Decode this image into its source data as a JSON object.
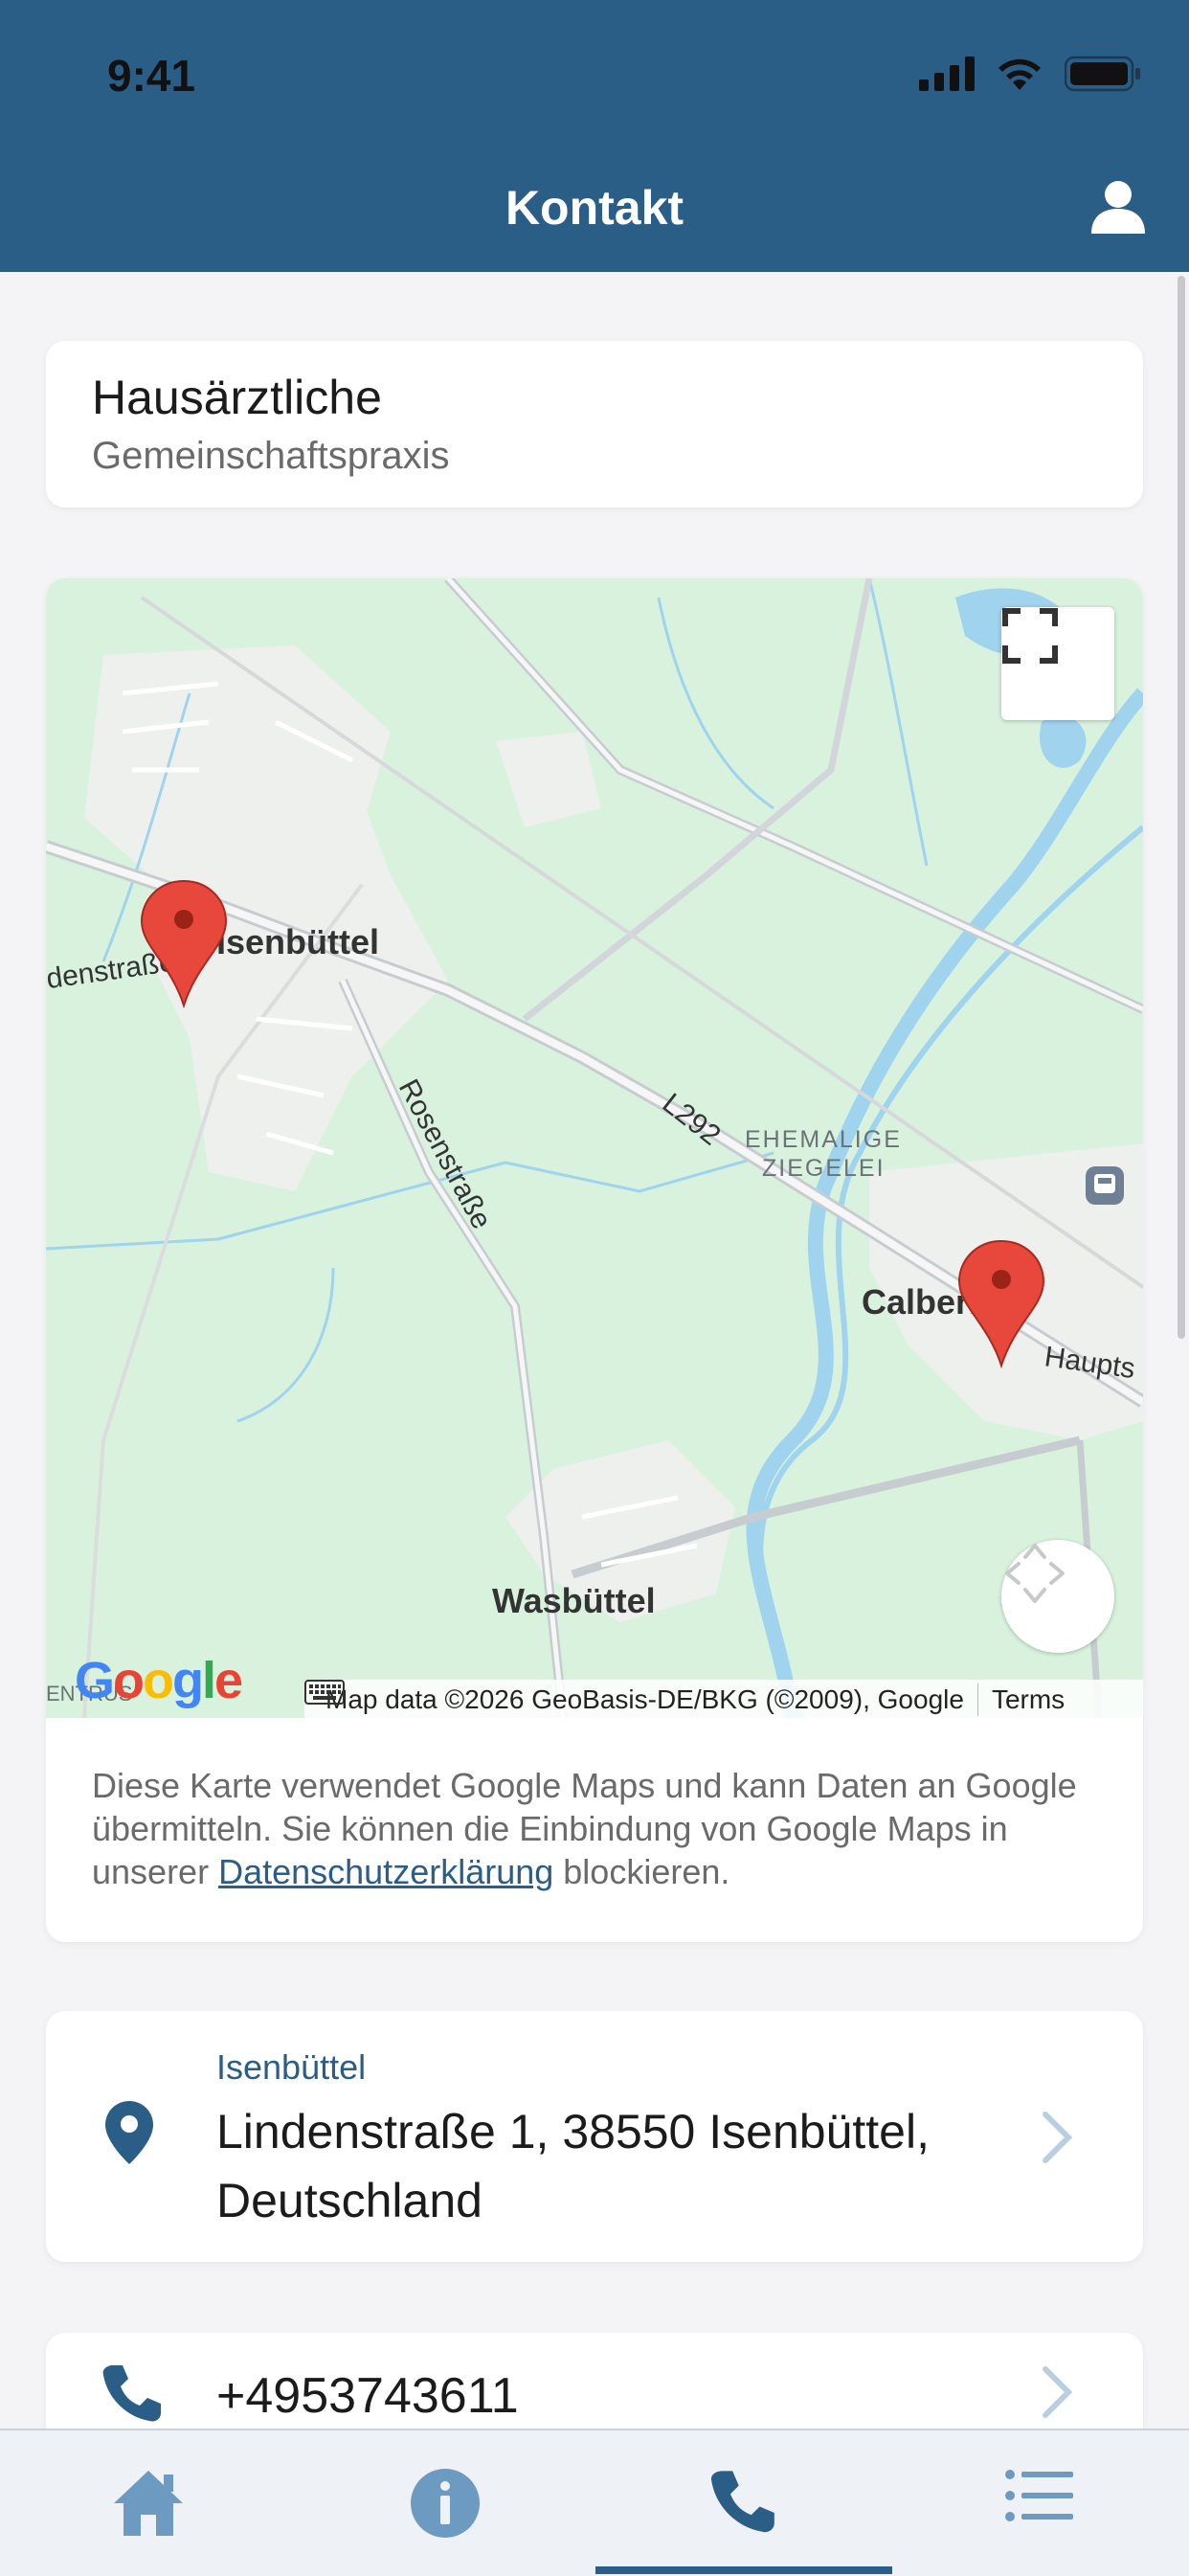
{
  "status_bar": {
    "time": "9:41"
  },
  "header": {
    "title": "Kontakt"
  },
  "practice": {
    "name": "Hausärztliche",
    "subtitle": "Gemeinschaftspraxis"
  },
  "map": {
    "labels": {
      "town1": "Isenbüttel",
      "town2": "Calberlah",
      "town3": "Wasbüttel",
      "street1": "Rosenstraße",
      "street2": "denstraße",
      "street3": "Haupts",
      "road": "L292",
      "poi_line1": "EHEMALIGE",
      "poi_line2": "ZIEGELEI",
      "edge_text": "ENTRUS"
    },
    "google_logo": "Google",
    "attribution": "Map data ©2026 GeoBasis-DE/BKG (©2009), Google",
    "terms": "Terms",
    "note_prefix": "Diese Karte verwendet Google Maps und kann Daten an Google übermitteln. Sie können die Einbindung von Google Maps in unserer ",
    "note_link": "Datenschutzerklärung",
    "note_suffix": " blockieren."
  },
  "address": {
    "label": "Isenbüttel",
    "text": "Lindenstraße 1, 38550 Isenbüttel, Deutschland"
  },
  "phone": {
    "number": "+4953743611"
  },
  "tabs": [
    {
      "name": "home",
      "icon": "home-icon"
    },
    {
      "name": "info",
      "icon": "info-icon"
    },
    {
      "name": "contact",
      "icon": "phone-icon",
      "active": true
    },
    {
      "name": "list",
      "icon": "list-icon"
    }
  ],
  "colors": {
    "header": "#2a5e87",
    "accent": "#2a5e87",
    "map_green": "#d8f2dd",
    "water": "#9fd3ee",
    "marker": "#e8473b"
  }
}
